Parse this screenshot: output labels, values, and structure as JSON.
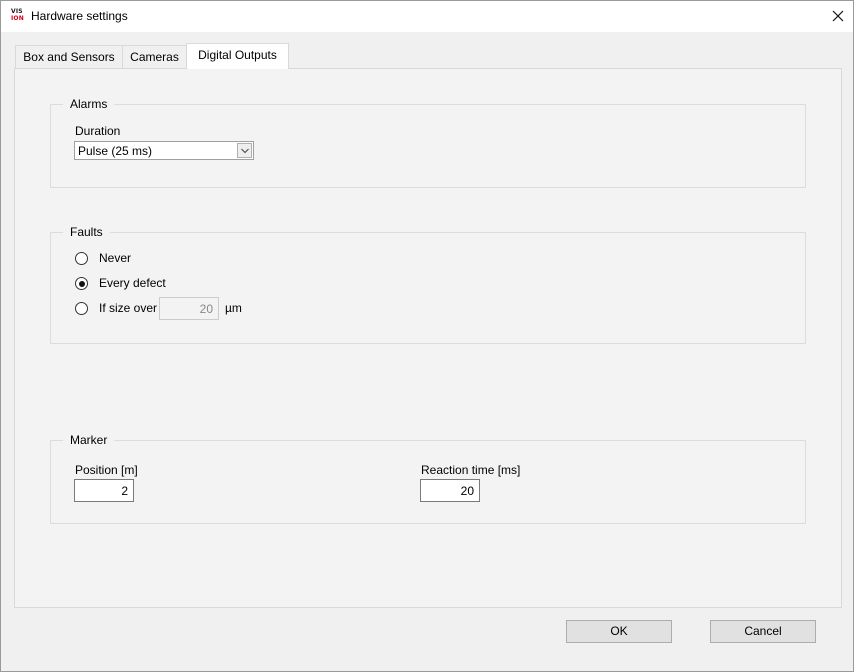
{
  "window": {
    "title": "Hardware settings",
    "logo": {
      "line1": "VIS",
      "line2": "ION",
      "colors": {
        "top": "#1a1a1a",
        "bottom": "#d0021b"
      }
    },
    "close_icon": "close-icon"
  },
  "tabs": [
    {
      "label": "Box and Sensors",
      "active": false
    },
    {
      "label": "Cameras",
      "active": false
    },
    {
      "label": "Digital Outputs",
      "active": true
    }
  ],
  "alarms": {
    "group_label": "Alarms",
    "duration_label": "Duration",
    "duration_value": "Pulse (25 ms)"
  },
  "faults": {
    "group_label": "Faults",
    "options": [
      {
        "label": "Never",
        "selected": false
      },
      {
        "label": "Every defect",
        "selected": true
      },
      {
        "label": "If size over",
        "selected": false
      }
    ],
    "size_value": "20",
    "size_unit": "µm"
  },
  "marker": {
    "group_label": "Marker",
    "position_label": "Position [m]",
    "position_value": "2",
    "reaction_label": "Reaction time [ms]",
    "reaction_value": "20"
  },
  "buttons": {
    "ok": "OK",
    "cancel": "Cancel"
  }
}
